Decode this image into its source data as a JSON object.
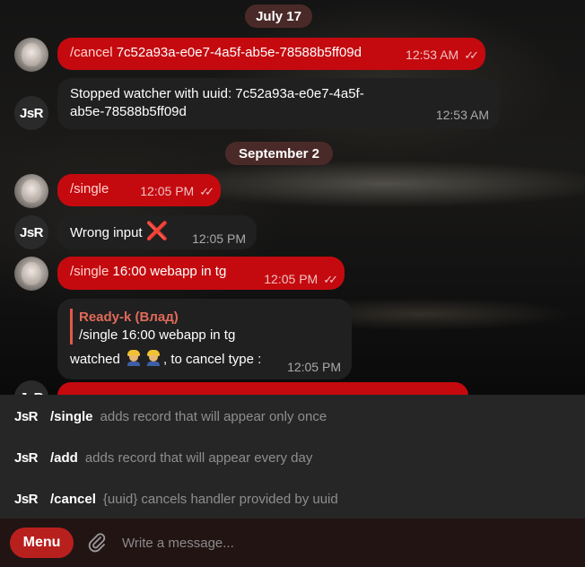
{
  "dates": {
    "first": "July 17",
    "second": "September 2"
  },
  "avatars": {
    "bot_initials": "JsR"
  },
  "messages": {
    "m1": {
      "command": "/cancel",
      "text": " 7c52a93a-e0e7-4a5f-ab5e-78588b5ff09d",
      "time": "12:53 AM"
    },
    "m2": {
      "line1": "Stopped watcher with uuid: 7c52a93a-e0e7-4a5f-",
      "line2": "ab5e-78588b5ff09d",
      "time": "12:53 AM"
    },
    "m3": {
      "command": "/single",
      "time": "12:05 PM"
    },
    "m4": {
      "text": "Wrong input",
      "emoji": "❌",
      "time": "12:05 PM"
    },
    "m5": {
      "command": "/single",
      "text": " 16:00 webapp in tg",
      "time": "12:05 PM"
    },
    "m6": {
      "reply_author": "Ready-k (Влад)",
      "reply_text": "/single 16:00 webapp in tg",
      "text_before": "watched ",
      "text_after": ", to cancel type :",
      "emoji_name": "construction-worker",
      "time": "12:05 PM"
    }
  },
  "commands": [
    {
      "name": "/single",
      "description": "adds record that will appear only once"
    },
    {
      "name": "/add",
      "description": "adds record that will appear every day"
    },
    {
      "name": "/cancel",
      "description": "{uuid} cancels handler provided by uuid"
    }
  ],
  "composer": {
    "menu_label": "Menu",
    "placeholder": "Write a message...",
    "attach_icon": "paperclip-icon"
  },
  "colors": {
    "outgoing_bubble": "#c40a0f",
    "incoming_bubble": "#202020",
    "menu_button": "#b8201e",
    "accent_name": "#e06a5a"
  }
}
